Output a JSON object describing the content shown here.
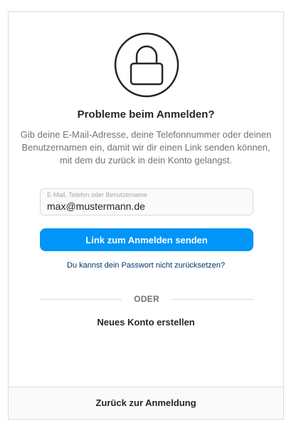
{
  "recover": {
    "title": "Probleme beim Anmelden?",
    "description": "Gib deine E-Mail-Adresse, deine Telefonnummer oder deinen Benutzernamen ein, damit wir dir einen Link senden können, mit dem du zurück in dein Konto gelangst.",
    "input_label": "E-Mail, Telefon oder Benutzername",
    "input_value": "max@mustermann.de",
    "send_button": "Link zum Anmelden senden",
    "cant_reset_link": "Du kannst dein Passwort nicht zurücksetzen?",
    "divider_text": "ODER",
    "new_account": "Neues Konto erstellen",
    "back_to_login": "Zurück zur Anmeldung"
  },
  "icons": {
    "lock": "lock-icon"
  },
  "colors": {
    "primary": "#0095f6",
    "text": "#262626",
    "muted": "#737373",
    "link": "#00376b",
    "border": "#dbdbdb"
  }
}
